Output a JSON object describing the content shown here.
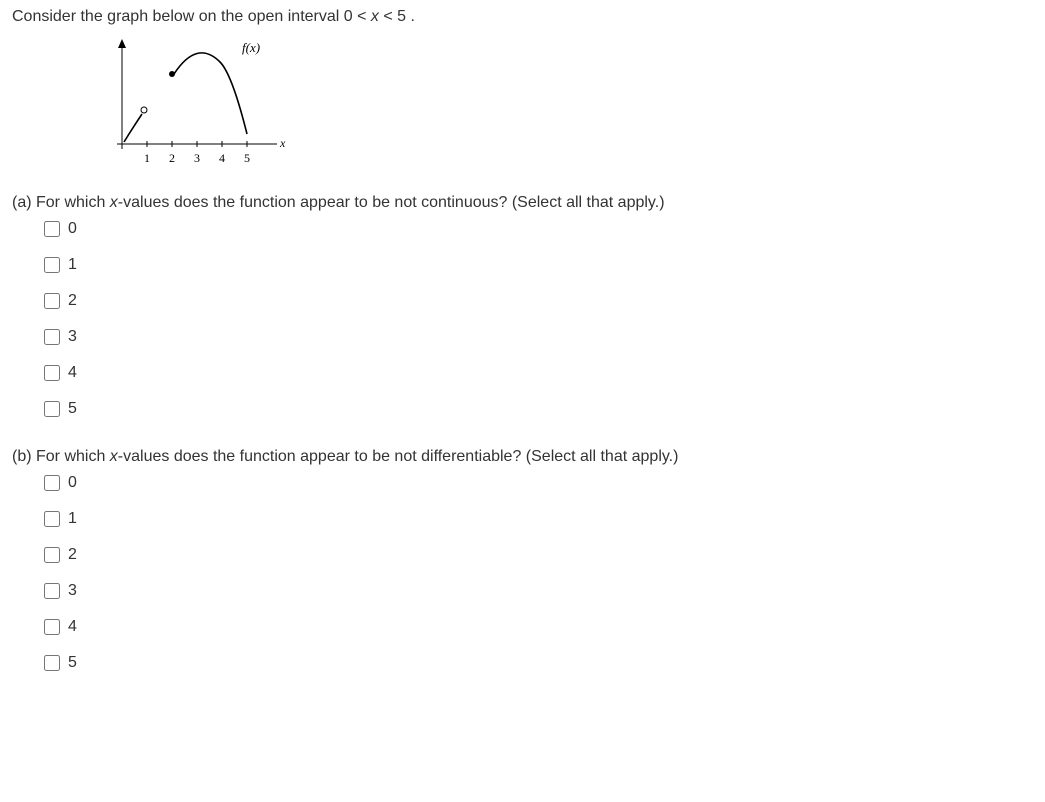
{
  "intro_prefix": "Consider the graph below on the open interval  0 < ",
  "intro_var": "x",
  "intro_suffix": " < 5 .",
  "graph": {
    "fx_label": "f(x)",
    "x_label": "x",
    "ticks": [
      "1",
      "2",
      "3",
      "4",
      "5"
    ]
  },
  "parts": {
    "a": {
      "label_prefix": "(a) For which ",
      "label_var": "x",
      "label_suffix": "-values does the function appear to be not continuous? (Select all that apply.)",
      "options": [
        "0",
        "1",
        "2",
        "3",
        "4",
        "5"
      ]
    },
    "b": {
      "label_prefix": "(b) For which ",
      "label_var": "x",
      "label_suffix": "-values does the function appear to be not differentiable? (Select all that apply.)",
      "options": [
        "0",
        "1",
        "2",
        "3",
        "4",
        "5"
      ]
    }
  }
}
